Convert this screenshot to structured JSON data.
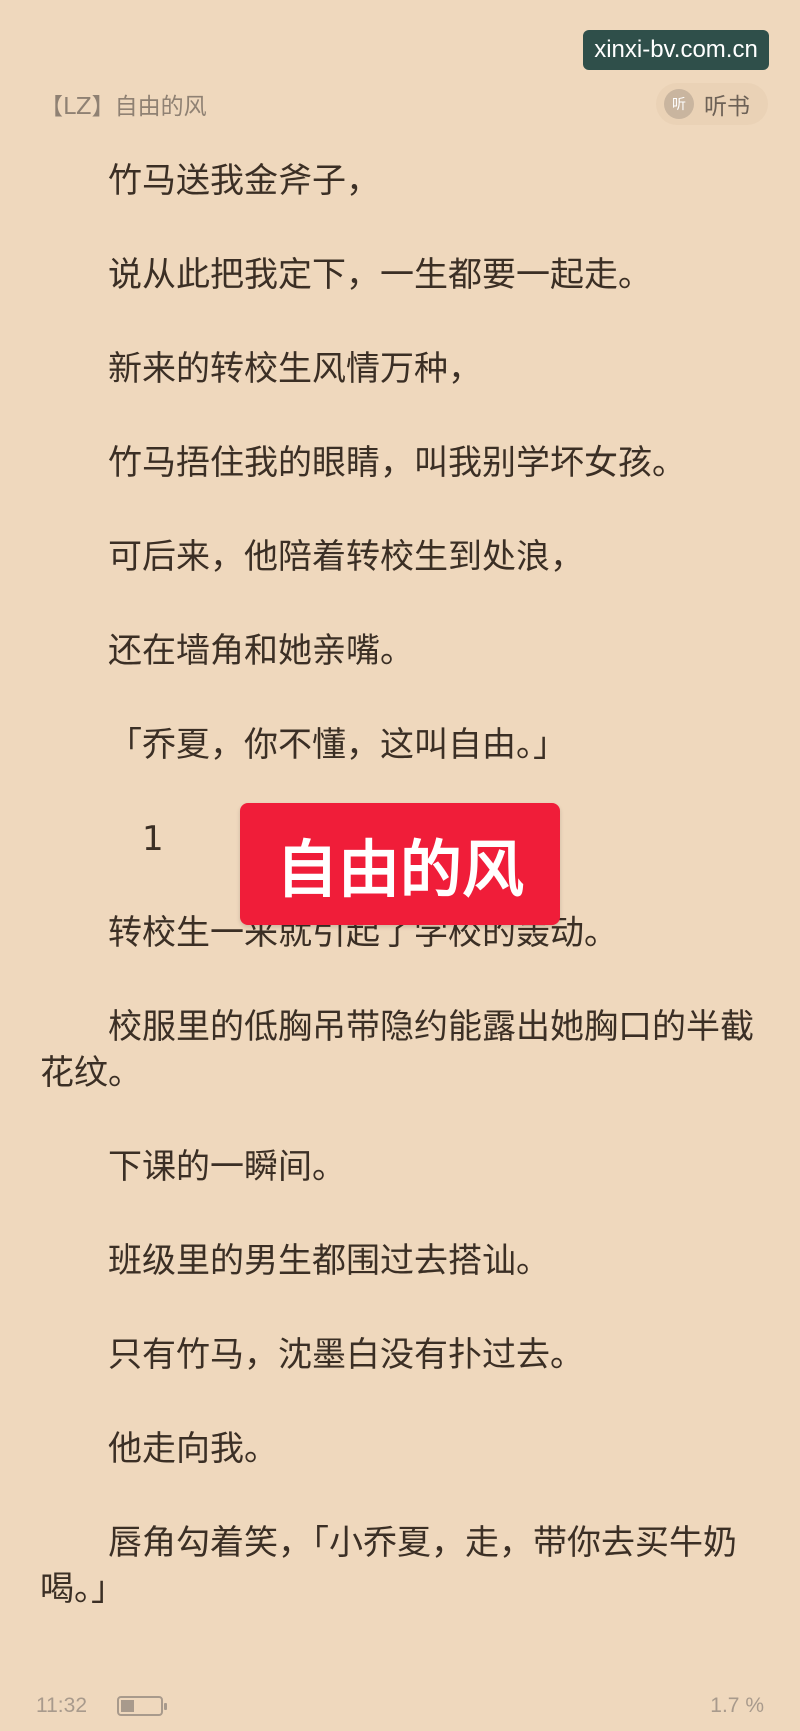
{
  "watermark": "xinxi-bv.com.cn",
  "header": {
    "book_title": "【LZ】自由的风",
    "listen_icon_glyph": "听",
    "listen_label": "听书"
  },
  "paragraphs": [
    "竹马送我金斧子，",
    "说从此把我定下，一生都要一起走。",
    "新来的转校生风情万种，",
    "竹马捂住我的眼睛，叫我别学坏女孩。",
    "可后来，他陪着转校生到处浪，",
    "还在墙角和她亲嘴。",
    "「乔夏，你不懂，这叫自由。」",
    "1",
    "转校生一来就引起了学校的轰动。",
    "校服里的低胸吊带隐约能露出她胸口的半截花纹。",
    "下课的一瞬间。",
    "班级里的男生都围过去搭讪。",
    "只有竹马，沈墨白没有扑过去。",
    "他走向我。",
    "唇角勾着笑，「小乔夏，走，带你去买牛奶喝。」"
  ],
  "cover_overlay": "自由的风",
  "status": {
    "time": "11:32",
    "battery_level": 0.35,
    "progress": "1.7 %"
  },
  "colors": {
    "page_background": "#efd8bd",
    "overlay_red": "#f01d39",
    "watermark_bg": "#2f4f4a"
  }
}
